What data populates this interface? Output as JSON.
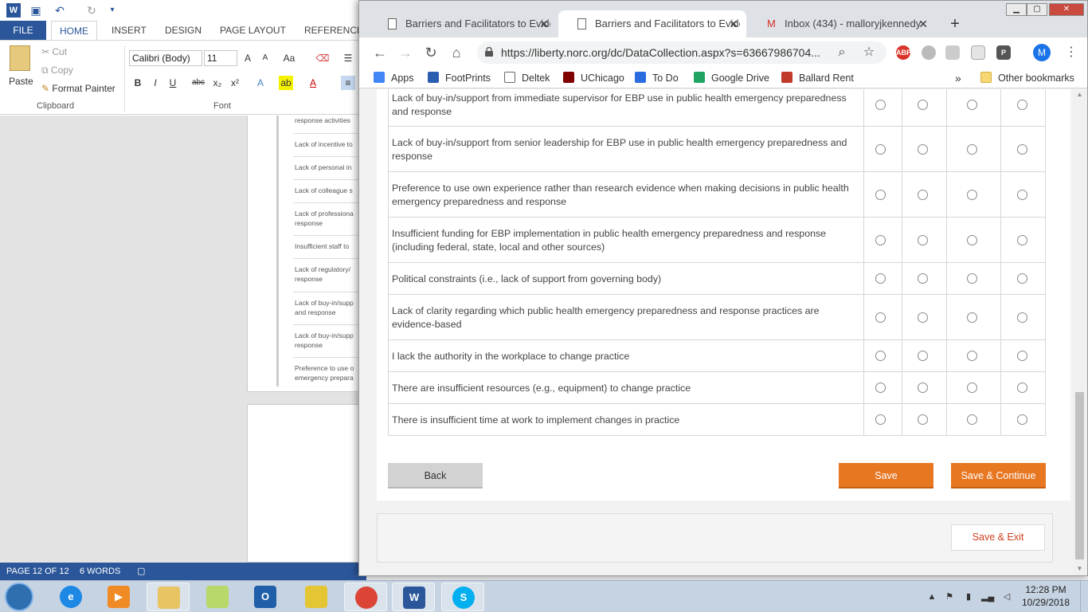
{
  "word": {
    "file_tab": "FILE",
    "tabs": [
      "HOME",
      "INSERT",
      "DESIGN",
      "PAGE LAYOUT",
      "REFERENCES"
    ],
    "clipboard": {
      "paste": "Paste",
      "cut": "Cut",
      "copy": "Copy",
      "format_painter": "Format Painter",
      "group": "Clipboard"
    },
    "font": {
      "name": "Calibri (Body)",
      "size": "11",
      "group": "Font"
    },
    "doc_rows": [
      "response activities",
      "Lack of incentive to",
      "Lack of personal in",
      "Lack of colleague s",
      "Lack of professiona",
      "response",
      "Insufficient staff to",
      "Lack of regulatory/",
      "response",
      "Lack of buy-in/supp",
      "and response",
      "Lack of buy-in/supp",
      "response",
      "Preference to use o",
      "emergency prepara"
    ],
    "status": {
      "page": "PAGE 12 OF 12",
      "words": "6 WORDS"
    }
  },
  "browser": {
    "tabs": [
      {
        "title": "Barriers and Facilitators to Evide"
      },
      {
        "title": "Barriers and Facilitators to Evide"
      },
      {
        "title": "Inbox (434) - malloryjkennedy@"
      }
    ],
    "url": "https://liberty.norc.org/dc/DataCollection.aspx?s=63667986704...",
    "avatar_letter": "M",
    "bookmarks": [
      {
        "label": "Apps",
        "color": "#4285f4"
      },
      {
        "label": "FootPrints",
        "color": "#2a5db0"
      },
      {
        "label": "Deltek",
        "color": "#777777"
      },
      {
        "label": "UChicago",
        "color": "#800000"
      },
      {
        "label": "To Do",
        "color": "#2b6de0"
      },
      {
        "label": "Google Drive",
        "color": "#1fa463"
      },
      {
        "label": "Ballard Rent",
        "color": "#c0392b"
      }
    ],
    "more_bookmarks": "»",
    "other_bookmarks": "Other bookmarks"
  },
  "survey": {
    "items": [
      "Lack of buy-in/support from immediate supervisor for EBP use in public health emergency preparedness and response",
      "Lack of buy-in/support from senior leadership for EBP use in public health emergency preparedness and response",
      "Preference to use own experience rather than research evidence when making decisions in public health emergency preparedness and response",
      "Insufficient funding for EBP implementation in public health emergency preparedness and response (including federal, state, local and other sources)",
      "Political constraints (i.e., lack of support from governing body)",
      "Lack of clarity regarding which public health emergency preparedness and response practices are evidence-based",
      "I lack the authority in the workplace to change practice",
      "There are insufficient resources (e.g., equipment) to change practice",
      "There is insufficient time at work to implement changes in practice"
    ],
    "buttons": {
      "back": "Back",
      "save": "Save",
      "save_continue": "Save & Continue",
      "save_exit": "Save & Exit"
    }
  },
  "taskbar": {
    "apps": [
      {
        "name": "internet-explorer",
        "glyph": "e",
        "color": "#1e88e5"
      },
      {
        "name": "media-player",
        "glyph": "▶",
        "color": "#f08a24"
      },
      {
        "name": "file-explorer",
        "glyph": "",
        "color": "#e8c463"
      },
      {
        "name": "sticky-notes",
        "glyph": "",
        "color": "#b8d96a"
      },
      {
        "name": "outlook",
        "glyph": "O",
        "color": "#1f5ea8"
      },
      {
        "name": "vpn-key",
        "glyph": "",
        "color": "#e4c534"
      },
      {
        "name": "chrome",
        "glyph": "",
        "color": "#db4437"
      },
      {
        "name": "word",
        "glyph": "W",
        "color": "#2b579a"
      },
      {
        "name": "skype",
        "glyph": "S",
        "color": "#00aff0"
      }
    ],
    "time": "12:28 PM",
    "date": "10/29/2018"
  }
}
